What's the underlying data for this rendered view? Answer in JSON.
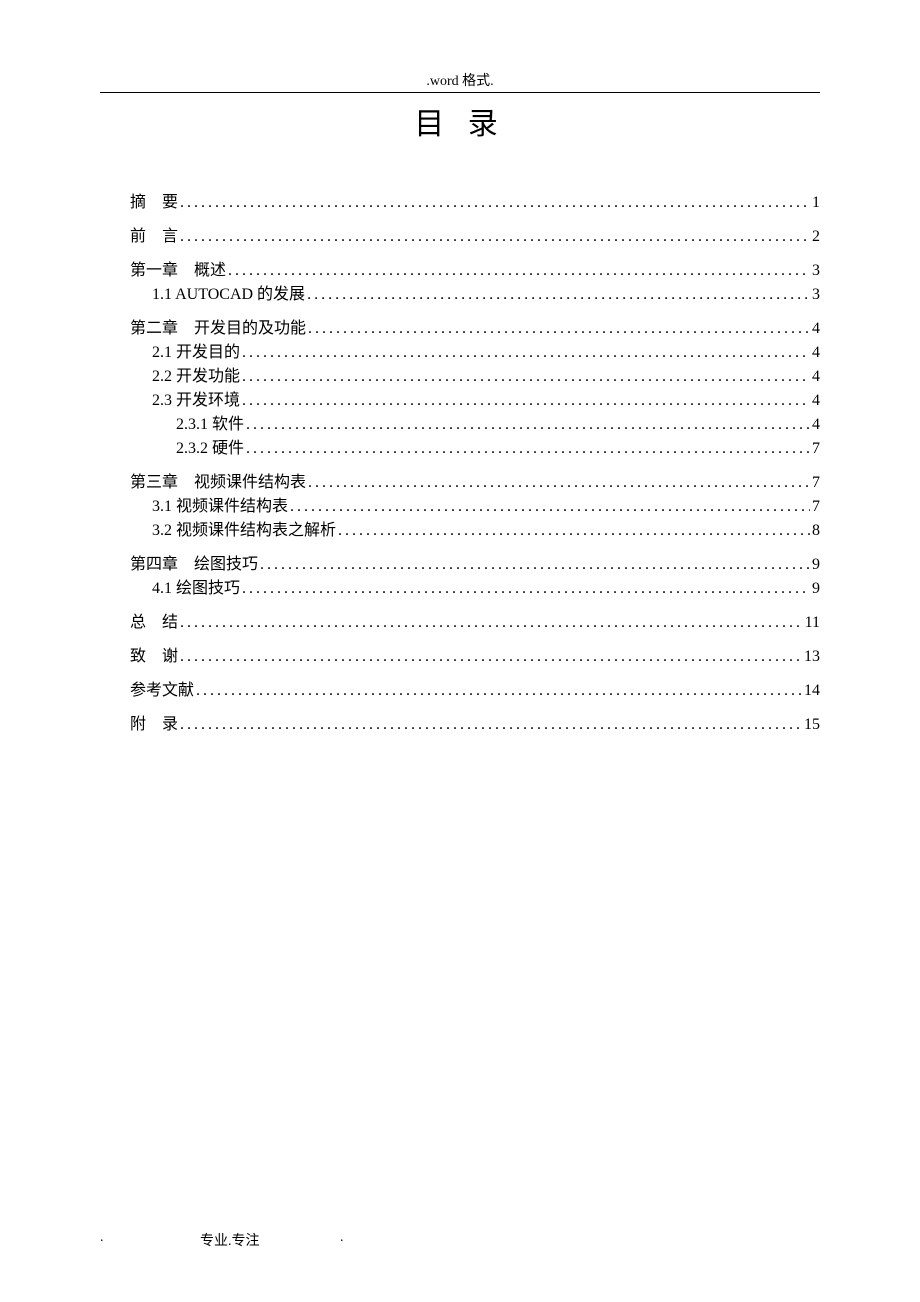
{
  "header": ".word 格式.",
  "title": "目 录",
  "toc": [
    {
      "level": 0,
      "label": "摘　要",
      "page": "1",
      "spaced": true
    },
    {
      "level": 0,
      "label": "前　言",
      "page": "2",
      "spaced": true
    },
    {
      "level": 0,
      "label": "第一章　概述",
      "page": "3"
    },
    {
      "level": 1,
      "label": "1.1 AUTOCAD 的发展 ",
      "page": "3"
    },
    {
      "level": 0,
      "label": "第二章　开发目的及功能",
      "page": "4"
    },
    {
      "level": 1,
      "label": "2.1 开发目的 ",
      "page": "4"
    },
    {
      "level": 1,
      "label": "2.2 开发功能 ",
      "page": "4"
    },
    {
      "level": 1,
      "label": "2.3 开发环境 ",
      "page": "4"
    },
    {
      "level": 2,
      "label": "2.3.1 软件 ",
      "page": "4"
    },
    {
      "level": 2,
      "label": "2.3.2 硬件 ",
      "page": "7"
    },
    {
      "level": 0,
      "label": "第三章　视频课件结构表",
      "page": "7"
    },
    {
      "level": 1,
      "label": "3.1 视频课件结构表 ",
      "page": "7"
    },
    {
      "level": 1,
      "label": "3.2 视频课件结构表之解析 ",
      "page": "8"
    },
    {
      "level": 0,
      "label": "第四章　绘图技巧",
      "page": "9"
    },
    {
      "level": 1,
      "label": "4.1 绘图技巧 ",
      "page": "9"
    },
    {
      "level": 0,
      "label": "总　结",
      "page": "11",
      "spaced": true
    },
    {
      "level": 0,
      "label": "致　谢",
      "page": "13",
      "spaced": true
    },
    {
      "level": 0,
      "label": "参考文献",
      "page": "14"
    },
    {
      "level": 0,
      "label": "附　录",
      "page": "15",
      "spaced": true
    }
  ],
  "footer": {
    "dot_left": ".",
    "center": "专业.专注",
    "dot_right": "."
  }
}
